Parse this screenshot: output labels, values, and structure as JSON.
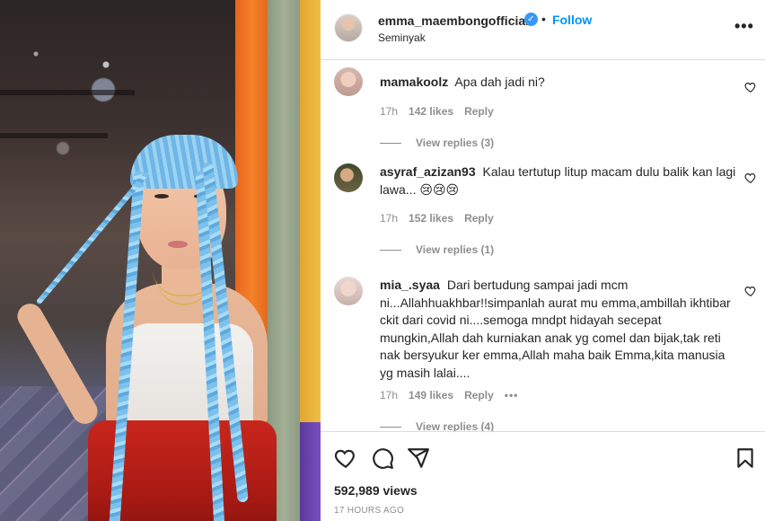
{
  "post": {
    "username": "emma_maembongofficial",
    "verified_mark": "✓",
    "separator": "•",
    "follow_label": "Follow",
    "location": "Seminyak",
    "more_icon": "•••"
  },
  "comments": [
    {
      "username": "mamakoolz",
      "text": "Apa dah jadi ni?",
      "time": "17h",
      "likes": "142 likes",
      "reply_label": "Reply",
      "view_replies": "View replies (3)"
    },
    {
      "username": "asyraf_azizan93",
      "text": "Kalau tertutup litup macam dulu balik kan lagi lawa... 😢😢😢",
      "time": "17h",
      "likes": "152 likes",
      "reply_label": "Reply",
      "view_replies": "View replies (1)"
    },
    {
      "username": "mia_.syaa",
      "text": "Dari bertudung sampai jadi mcm ni...Allahhuakhbar!!simpanlah aurat mu emma,ambillah ikhtibar ckit dari covid ni....semoga mndpt hidayah secepat mungkin,Allah dah kurniakan anak yg comel dan bijak,tak reti nak bersyukur ker emma,Allah maha baik Emma,kita manusia yg masih lalai....",
      "time": "17h",
      "likes": "149 likes",
      "reply_label": "Reply",
      "more": "•••",
      "view_replies": "View replies (4)"
    }
  ],
  "footer": {
    "views": "592,989 views",
    "time_ago": "17 HOURS AGO"
  },
  "icons": [
    "heart-icon",
    "comment-icon",
    "share-icon",
    "bookmark-icon",
    "more-icon",
    "verified-badge-icon"
  ]
}
